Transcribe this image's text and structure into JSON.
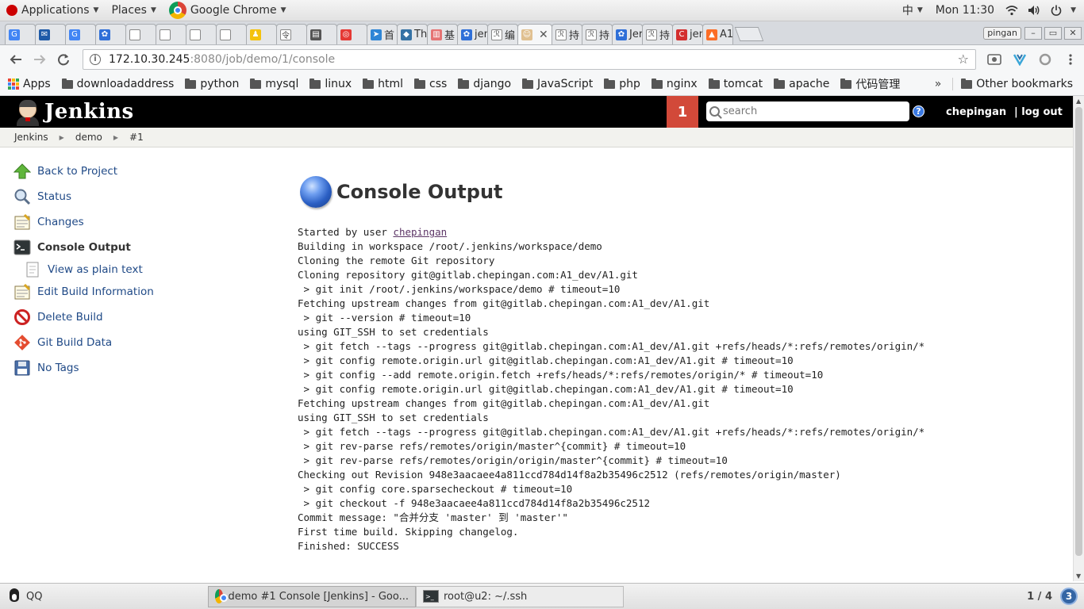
{
  "gnome": {
    "applications": "Applications",
    "places": "Places",
    "active_app": "Google Chrome",
    "input_method": "中",
    "clock": "Mon 11:30"
  },
  "tabs": [
    {
      "label": "",
      "color": "#4285f4",
      "glyph": "G"
    },
    {
      "label": "",
      "color": "#1e5aa8",
      "glyph": "✉"
    },
    {
      "label": "",
      "color": "#4285f4",
      "glyph": "G"
    },
    {
      "label": "",
      "color": "#2f6fd8",
      "glyph": "✿"
    },
    {
      "label": "",
      "color": "#ffffff",
      "glyph": ""
    },
    {
      "label": "",
      "color": "#ffffff",
      "glyph": ""
    },
    {
      "label": "",
      "color": "#ffffff",
      "glyph": ""
    },
    {
      "label": "",
      "color": "#ffffff",
      "glyph": ""
    },
    {
      "label": "",
      "color": "#f4c20d",
      "glyph": "♟"
    },
    {
      "label": "",
      "color": "#ffffff",
      "glyph": "令"
    },
    {
      "label": "",
      "color": "#555555",
      "glyph": "▤"
    },
    {
      "label": "",
      "color": "#e53935",
      "glyph": "◎"
    },
    {
      "label": "首",
      "color": "#2f86d6",
      "glyph": "➤"
    },
    {
      "label": "The",
      "color": "#3572a5",
      "glyph": "◆"
    },
    {
      "label": "基",
      "color": "#e57373",
      "glyph": "▥"
    },
    {
      "label": "jen",
      "color": "#2f6fd8",
      "glyph": "✿"
    },
    {
      "label": "编",
      "color": "#ffffff",
      "glyph": "ℛ"
    },
    {
      "label": "",
      "color": "#e0c090",
      "glyph": "☺",
      "active": true
    },
    {
      "label": "持",
      "color": "#ffffff",
      "glyph": "ℛ"
    },
    {
      "label": "持",
      "color": "#ffffff",
      "glyph": "ℛ"
    },
    {
      "label": "Jer",
      "color": "#2f6fd8",
      "glyph": "✿"
    },
    {
      "label": "持",
      "color": "#ffffff",
      "glyph": "ℛ"
    },
    {
      "label": "jen",
      "color": "#d32f2f",
      "glyph": "C"
    },
    {
      "label": "A1",
      "color": "#fc6d26",
      "glyph": "▲"
    }
  ],
  "profile_name": "pingan",
  "address": {
    "host": "172.10.30.245",
    "path": ":8080/job/demo/1/console"
  },
  "bookmarks": {
    "apps": "Apps",
    "folders": [
      "downloadaddress",
      "python",
      "mysql",
      "linux",
      "html",
      "css",
      "django",
      "JavaScript",
      "php",
      "nginx",
      "tomcat",
      "apache",
      "代码管理"
    ],
    "more": "»",
    "other": "Other bookmarks"
  },
  "jenkins": {
    "title": "Jenkins",
    "notification_count": "1",
    "search_placeholder": "search",
    "help": "?",
    "user": "chepingan",
    "logout": "| log out"
  },
  "breadcrumb": [
    "Jenkins",
    "demo",
    "#1"
  ],
  "side_tasks": [
    {
      "label": "Back to Project",
      "icon": "up-arrow-icon"
    },
    {
      "label": "Status",
      "icon": "magnifier-icon"
    },
    {
      "label": "Changes",
      "icon": "notepad-icon"
    },
    {
      "label": "Console Output",
      "icon": "terminal-icon",
      "current": true
    },
    {
      "label": "View as plain text",
      "icon": "document-icon",
      "sub": true
    },
    {
      "label": "Edit Build Information",
      "icon": "notepad-icon"
    },
    {
      "label": "Delete Build",
      "icon": "no-entry-icon"
    },
    {
      "label": "Git Build Data",
      "icon": "git-icon"
    },
    {
      "label": "No Tags",
      "icon": "floppy-icon"
    }
  ],
  "page_title": "Console Output",
  "console": {
    "started_prefix": "Started by user ",
    "started_user": "chepingan",
    "lines": [
      "Building in workspace /root/.jenkins/workspace/demo",
      "Cloning the remote Git repository",
      "Cloning repository git@gitlab.chepingan.com:A1_dev/A1.git",
      " > git init /root/.jenkins/workspace/demo # timeout=10",
      "Fetching upstream changes from git@gitlab.chepingan.com:A1_dev/A1.git",
      " > git --version # timeout=10",
      "using GIT_SSH to set credentials",
      " > git fetch --tags --progress git@gitlab.chepingan.com:A1_dev/A1.git +refs/heads/*:refs/remotes/origin/*",
      " > git config remote.origin.url git@gitlab.chepingan.com:A1_dev/A1.git # timeout=10",
      " > git config --add remote.origin.fetch +refs/heads/*:refs/remotes/origin/* # timeout=10",
      " > git config remote.origin.url git@gitlab.chepingan.com:A1_dev/A1.git # timeout=10",
      "Fetching upstream changes from git@gitlab.chepingan.com:A1_dev/A1.git",
      "using GIT_SSH to set credentials",
      " > git fetch --tags --progress git@gitlab.chepingan.com:A1_dev/A1.git +refs/heads/*:refs/remotes/origin/*",
      " > git rev-parse refs/remotes/origin/master^{commit} # timeout=10",
      " > git rev-parse refs/remotes/origin/origin/master^{commit} # timeout=10",
      "Checking out Revision 948e3aacaee4a811ccd784d14f8a2b35496c2512 (refs/remotes/origin/master)",
      " > git config core.sparsecheckout # timeout=10",
      " > git checkout -f 948e3aacaee4a811ccd784d14f8a2b35496c2512",
      "Commit message: \"合并分支 'master' 到 'master'\"",
      "First time build. Skipping changelog.",
      "Finished: SUCCESS"
    ]
  },
  "taskbar": {
    "qq": "QQ",
    "chrome_window": "demo #1 Console [Jenkins] - Goo...",
    "terminal_window": "root@u2: ~/.ssh",
    "workspace": "1 / 4",
    "workspace_badge": "3"
  },
  "colors": {
    "jenkins_header": "#000000",
    "notification": "#d24939",
    "link": "#204a87"
  }
}
